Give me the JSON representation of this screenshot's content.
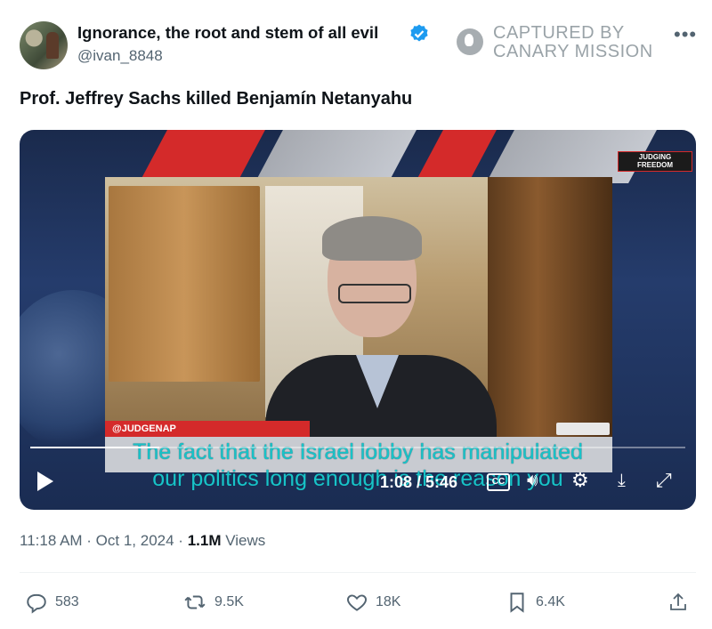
{
  "tweet": {
    "display_name": "Ignorance, the root and stem of all evil",
    "handle": "@ivan_8848",
    "text": "Prof. Jeffrey Sachs killed Benjamín Netanyahu",
    "timestamp": "11:18 AM · Oct 1, 2024",
    "views_count": "1.1M",
    "views_label": "Views"
  },
  "watermark": {
    "line1": "CAPTURED BY",
    "line2": "CANARY MISSION"
  },
  "video": {
    "brand_line1": "JUDGING",
    "brand_line2": "FREEDOM",
    "onscreen_handle": "@JUDGENAP",
    "caption_line1": "The fact that the Israel lobby has manipulated",
    "caption_line2": "our politics long enough is the reason you",
    "time": "1:08 / 5:46",
    "progress": 0.197,
    "cc_label": "CC"
  },
  "actions": {
    "replies": "583",
    "reposts": "9.5K",
    "likes": "18K",
    "bookmarks": "6.4K"
  },
  "colors": {
    "verified": "#1d9bf0",
    "caption": "#18c3c8",
    "muted_text": "#536471"
  }
}
